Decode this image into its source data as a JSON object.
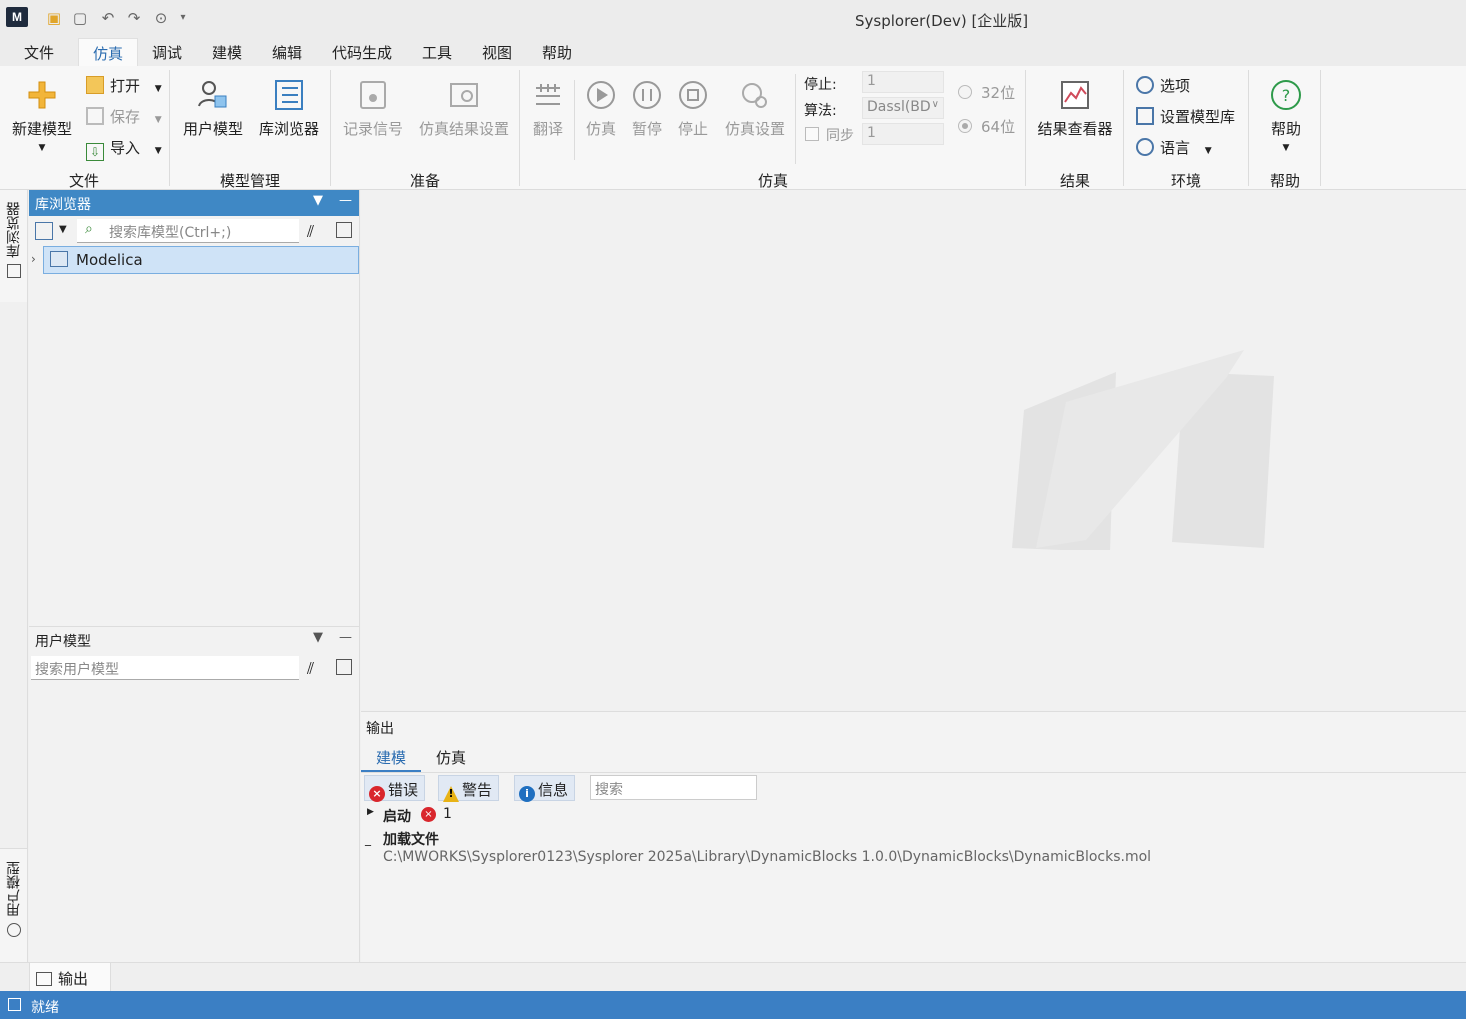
{
  "app": {
    "title": "Sysplorer(Dev) [企业版]",
    "logo_text": "M"
  },
  "menu": [
    "文件",
    "仿真",
    "调试",
    "建模",
    "编辑",
    "代码生成",
    "工具",
    "视图",
    "帮助"
  ],
  "ribbon": {
    "file": {
      "new_model": "新建模型",
      "open": "打开",
      "save": "保存",
      "import": "导入",
      "group": "文件"
    },
    "model_mgmt": {
      "user_model": "用户模型",
      "lib_browser": "库浏览器",
      "group": "模型管理"
    },
    "prepare": {
      "record_signal": "记录信号",
      "sim_result_settings": "仿真结果设置",
      "group": "准备"
    },
    "simulation": {
      "translate": "翻译",
      "simulate": "仿真",
      "pause": "暂停",
      "stop": "停止",
      "sim_settings": "仿真设置",
      "stop_label": "停止:",
      "stop_value": "1",
      "algo_label": "算法:",
      "algo_value": "Dassl(BD",
      "sync_label": "同步",
      "sync_value": "1",
      "bit32": "32位",
      "bit64": "64位",
      "group": "仿真"
    },
    "results": {
      "viewer": "结果查看器",
      "group": "结果"
    },
    "env": {
      "options": "选项",
      "set_lib": "设置模型库",
      "language": "语言",
      "group": "环境"
    },
    "help": {
      "help": "帮助",
      "group": "帮助"
    }
  },
  "side_tabs": {
    "lib": "库浏览器",
    "user": "用户模型"
  },
  "lib_panel": {
    "title": "库浏览器",
    "search_placeholder": "搜索库模型(Ctrl+;)",
    "tree": [
      "Modelica"
    ]
  },
  "user_panel": {
    "title": "用户模型",
    "search_placeholder": "搜索用户模型"
  },
  "output": {
    "title": "输出",
    "tabs": [
      "建模",
      "仿真"
    ],
    "filters": {
      "error": "错误",
      "warning": "警告",
      "info": "信息"
    },
    "search_placeholder": "搜索",
    "entries": [
      {
        "title": "启动",
        "count": "1"
      },
      {
        "title": "加载文件",
        "detail": "C:\\MWORKS\\Sysplorer0123\\Sysplorer 2025a\\Library\\DynamicBlocks 1.0.0\\DynamicBlocks\\DynamicBlocks.mol"
      }
    ]
  },
  "bottom_tab": "输出",
  "status": "就绪",
  "colors": {
    "accent": "#3b7fc4",
    "panel_header": "#3f88c5",
    "tree_selected": "#cfe3f7"
  }
}
